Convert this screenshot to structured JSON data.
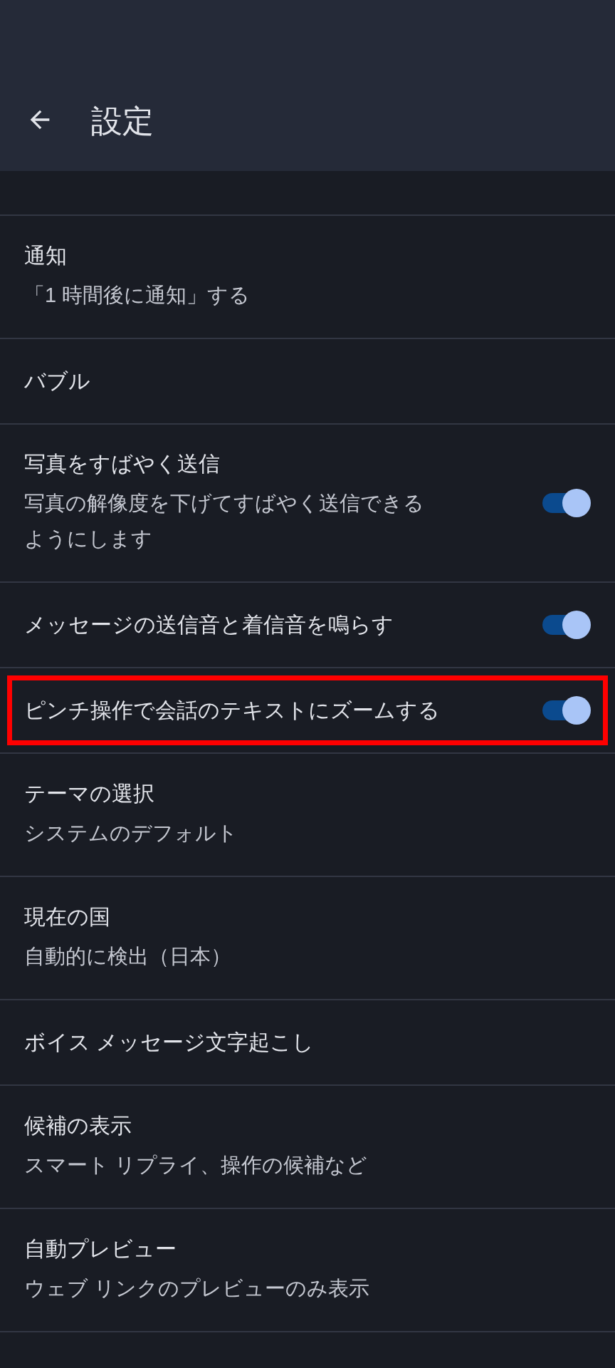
{
  "header": {
    "title": "設定"
  },
  "items": [
    {
      "title": "通知",
      "subtitle": "「1 時間後に通知」する"
    },
    {
      "title": "バブル"
    },
    {
      "title": "写真をすばやく送信",
      "subtitle": "写真の解像度を下げてすばやく送信できるようにします",
      "toggle": {
        "on": true
      }
    },
    {
      "title": "メッセージの送信音と着信音を鳴らす",
      "toggle": {
        "on": true
      }
    },
    {
      "title": "ピンチ操作で会話のテキストにズームする",
      "toggle": {
        "on": true
      },
      "highlighted": true
    },
    {
      "title": "テーマの選択",
      "subtitle": "システムのデフォルト"
    },
    {
      "title": "現在の国",
      "subtitle": "自動的に検出（日本）"
    },
    {
      "title": "ボイス メッセージ文字起こし"
    },
    {
      "title": "候補の表示",
      "subtitle": "スマート リプライ、操作の候補など"
    },
    {
      "title": "自動プレビュー",
      "subtitle": "ウェブ リンクのプレビューのみ表示"
    }
  ]
}
